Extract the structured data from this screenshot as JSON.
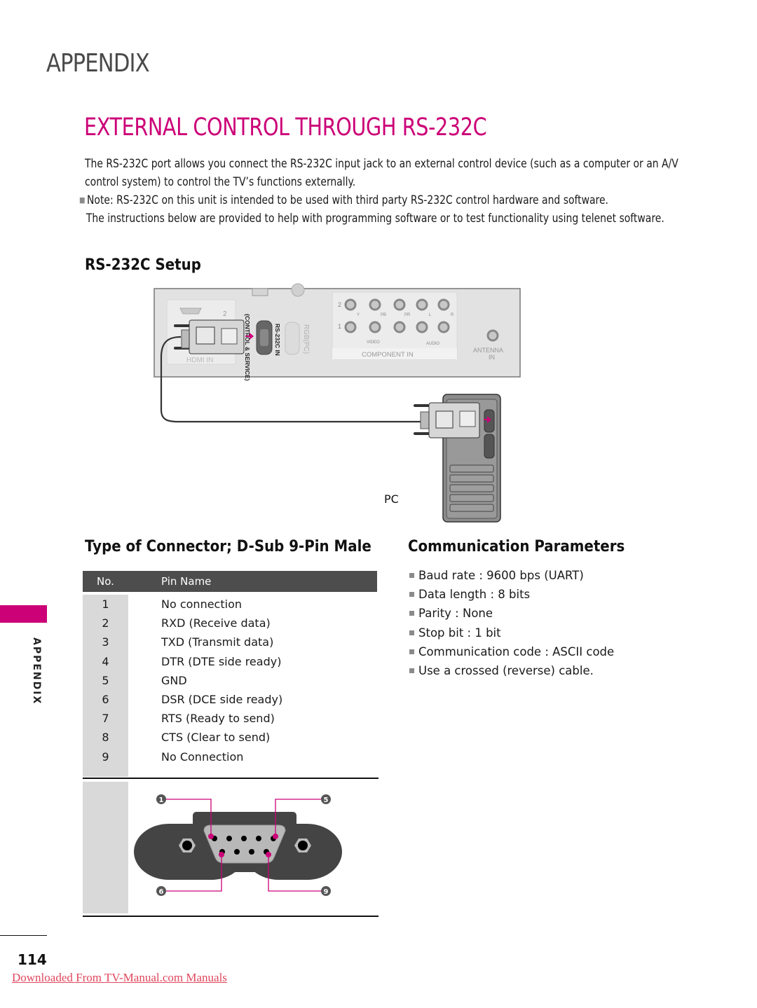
{
  "section_label": "APPENDIX",
  "page_title": "EXTERNAL CONTROL THROUGH RS-232C",
  "intro_text": "The RS-232C port allows you connect the RS-232C input jack to an external control device (such as a computer or an A/V control system) to control the TV’s functions externally.",
  "note": {
    "line1": "Note: RS-232C on this unit is intended to be used with third party RS-232C control hardware and software.",
    "line2": "The instructions below are provided to help with programming software or to test functionality using telenet software."
  },
  "setup": {
    "title": "RS-232C Setup",
    "tv_panel_labels": {
      "hdmi_number": "2",
      "hdmi_in": "HDMI IN",
      "control_service": "(CONTROL & SERVICE)",
      "rs232c_in": "RS-232C IN",
      "rgb_pc": "RGB(PC)",
      "row2": "2",
      "row1": "1",
      "y": "Y",
      "pb": "PB",
      "pr": "PR",
      "l": "L",
      "r": "R",
      "video": "VIDEO",
      "audio": "AUDIO",
      "component_in": "COMPONENT IN",
      "antenna_in_1": "ANTENNA",
      "antenna_in_2": "IN"
    },
    "pc_label": "PC"
  },
  "connector": {
    "title": "Type of Connector; D-Sub 9-Pin Male",
    "columns": [
      "No.",
      "Pin Name"
    ],
    "rows": [
      {
        "no": "1",
        "name": "No connection"
      },
      {
        "no": "2",
        "name": "RXD (Receive data)"
      },
      {
        "no": "3",
        "name": "TXD (Transmit data)"
      },
      {
        "no": "4",
        "name": "DTR (DTE side ready)"
      },
      {
        "no": "5",
        "name": "GND"
      },
      {
        "no": "6",
        "name": "DSR (DCE side ready)"
      },
      {
        "no": "7",
        "name": "RTS (Ready to send)"
      },
      {
        "no": "8",
        "name": "CTS (Clear to send)"
      },
      {
        "no": "9",
        "name": "No Connection"
      }
    ],
    "pin_callouts": [
      "1",
      "5",
      "6",
      "9"
    ]
  },
  "parameters": {
    "title": "Communication Parameters",
    "items": [
      "Baud rate : 9600 bps (UART)",
      "Data length : 8 bits",
      "Parity : None",
      "Stop bit : 1 bit",
      "Communication code : ASCII code",
      "Use a crossed (reverse) cable."
    ]
  },
  "side_tab_label": "APPENDIX",
  "page_number": "114",
  "footer_link": "Downloaded From TV-Manual.com Manuals",
  "colors": {
    "accent": "#cc0077",
    "table_header": "#4d4d4d",
    "grey_column": "#d9d9d9",
    "link": "#e0475c"
  }
}
